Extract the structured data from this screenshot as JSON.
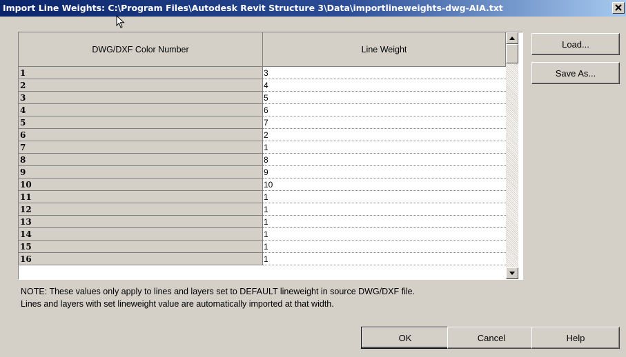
{
  "window": {
    "title": "Import Line Weights: C:\\Program Files\\Autodesk Revit Structure 3\\Data\\importlineweights-dwg-AIA.txt",
    "close_icon": "close-x-icon",
    "cursor_icon": "arrow-cursor-icon"
  },
  "grid": {
    "headers": {
      "color_number": "DWG/DXF Color Number",
      "line_weight": "Line Weight"
    },
    "rows": [
      {
        "color": "1",
        "weight": "3"
      },
      {
        "color": "2",
        "weight": "4"
      },
      {
        "color": "3",
        "weight": "5"
      },
      {
        "color": "4",
        "weight": "6"
      },
      {
        "color": "5",
        "weight": "7"
      },
      {
        "color": "6",
        "weight": "2"
      },
      {
        "color": "7",
        "weight": "1"
      },
      {
        "color": "8",
        "weight": "8"
      },
      {
        "color": "9",
        "weight": "9"
      },
      {
        "color": "10",
        "weight": "10"
      },
      {
        "color": "11",
        "weight": "1"
      },
      {
        "color": "12",
        "weight": "1"
      },
      {
        "color": "13",
        "weight": "1"
      },
      {
        "color": "14",
        "weight": "1"
      },
      {
        "color": "15",
        "weight": "1"
      },
      {
        "color": "16",
        "weight": "1"
      }
    ],
    "scroll_icons": {
      "up": "arrow-up-icon",
      "down": "arrow-down-icon"
    }
  },
  "buttons": {
    "load": "Load...",
    "save_as": "Save As...",
    "ok": "OK",
    "cancel": "Cancel",
    "help": "Help"
  },
  "note": {
    "line1": "NOTE: These values only apply to lines and layers set to DEFAULT lineweight in source DWG/DXF file.",
    "line2": "Lines and layers with set lineweight value are automatically imported at that width."
  }
}
